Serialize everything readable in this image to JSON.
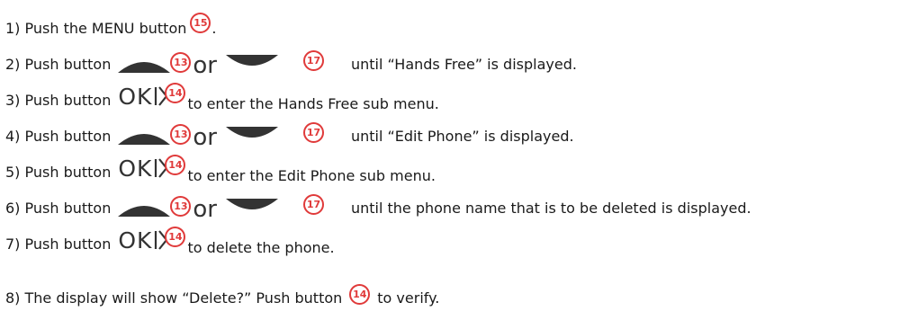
{
  "steps": [
    {
      "pre": "1) Push the MENU button",
      "badge": "15",
      "post": "."
    },
    {
      "pre": "2) Push button",
      "badge_up": "13",
      "or": "or",
      "badge_down": "17",
      "post": "until “Hands Free” is displayed."
    },
    {
      "pre": "3) Push button",
      "ok": "OK",
      "badge": "14",
      "post": "to enter the Hands Free sub menu."
    },
    {
      "pre": "4) Push button",
      "badge_up": "13",
      "or": "or",
      "badge_down": "17",
      "post": "until “Edit Phone” is displayed."
    },
    {
      "pre": "5) Push button",
      "ok": "OK",
      "badge": "14",
      "post": "to enter the Edit Phone sub menu."
    },
    {
      "pre": "6) Push button",
      "badge_up": "13",
      "or": "or",
      "badge_down": "17",
      "post": "until the phone name that is to be deleted is displayed."
    },
    {
      "pre": "7) Push button",
      "ok": "OK",
      "badge": "14",
      "post": "to delete the phone."
    },
    {
      "pre": "8) The display will show “Delete?” Push button",
      "badge": "14",
      "post": "to verify."
    }
  ],
  "colors": {
    "badge": "#e03a3a",
    "icon": "#333333"
  }
}
